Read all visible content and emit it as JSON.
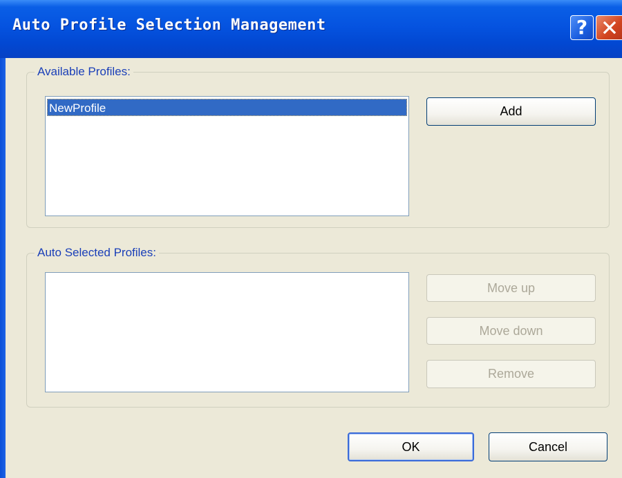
{
  "window": {
    "title": "Auto Profile Selection Management",
    "help_glyph": "?",
    "close_icon": "close-icon"
  },
  "available": {
    "label": "Available Profiles:",
    "items": [
      "NewProfile"
    ],
    "add_label": "Add"
  },
  "auto": {
    "label": "Auto Selected Profiles:",
    "items": [],
    "move_up_label": "Move up",
    "move_down_label": "Move down",
    "remove_label": "Remove"
  },
  "footer": {
    "ok_label": "OK",
    "cancel_label": "Cancel"
  },
  "colors": {
    "title_blue": "#0553e0",
    "selection": "#316ac5",
    "group_label": "#1a3fb8",
    "face": "#ece9d8"
  }
}
